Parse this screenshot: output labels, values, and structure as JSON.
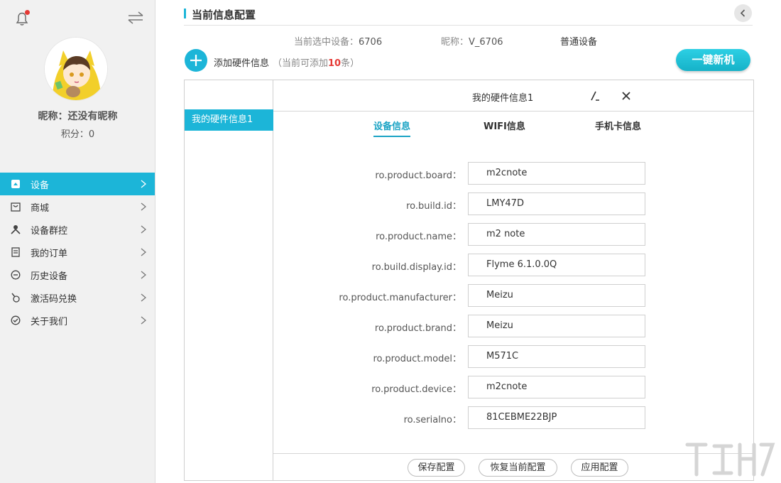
{
  "sidebar": {
    "nickname": "昵称：还没有昵称",
    "points": "积分：0",
    "items": [
      {
        "label": "设备",
        "icon": "device-icon",
        "active": true
      },
      {
        "label": "商城",
        "icon": "mall-icon"
      },
      {
        "label": "设备群控",
        "icon": "group-control-icon"
      },
      {
        "label": "我的订单",
        "icon": "order-icon"
      },
      {
        "label": "历史设备",
        "icon": "history-icon"
      },
      {
        "label": "激活码兑换",
        "icon": "activation-icon"
      },
      {
        "label": "关于我们",
        "icon": "about-icon"
      }
    ]
  },
  "header": {
    "title": "当前信息配置"
  },
  "device": {
    "selected_label": "当前选中设备：",
    "selected_value": "6706",
    "nickname_label": "昵称：",
    "nickname_value": "V_6706",
    "type": "普通设备"
  },
  "toolbar": {
    "add_label": "添加硬件信息",
    "hint_prefix": "（当前可添加",
    "hint_count": "10",
    "hint_suffix": "条）",
    "new_phone_label": "一键新机"
  },
  "panel": {
    "hw_list": [
      "我的硬件信息1"
    ],
    "hw_title": "我的硬件信息1",
    "tabs": [
      "设备信息",
      "WIFI信息",
      "手机卡信息"
    ],
    "fields": [
      {
        "label": "ro.product.board：",
        "value": "m2cnote"
      },
      {
        "label": "ro.build.id：",
        "value": "LMY47D"
      },
      {
        "label": "ro.product.name：",
        "value": "m2 note"
      },
      {
        "label": "ro.build.display.id：",
        "value": "Flyme 6.1.0.0Q"
      },
      {
        "label": "ro.product.manufacturer：",
        "value": "Meizu"
      },
      {
        "label": "ro.product.brand：",
        "value": "Meizu"
      },
      {
        "label": "ro.product.model：",
        "value": "M571C"
      },
      {
        "label": "ro.product.device：",
        "value": "m2cnote"
      },
      {
        "label": "ro.serialno：",
        "value": "81CEBME22BJP"
      }
    ],
    "buttons": [
      "保存配置",
      "恢复当前配置",
      "应用配置"
    ]
  },
  "colors": {
    "accent": "#1cb5d8",
    "alert": "#e53935"
  }
}
